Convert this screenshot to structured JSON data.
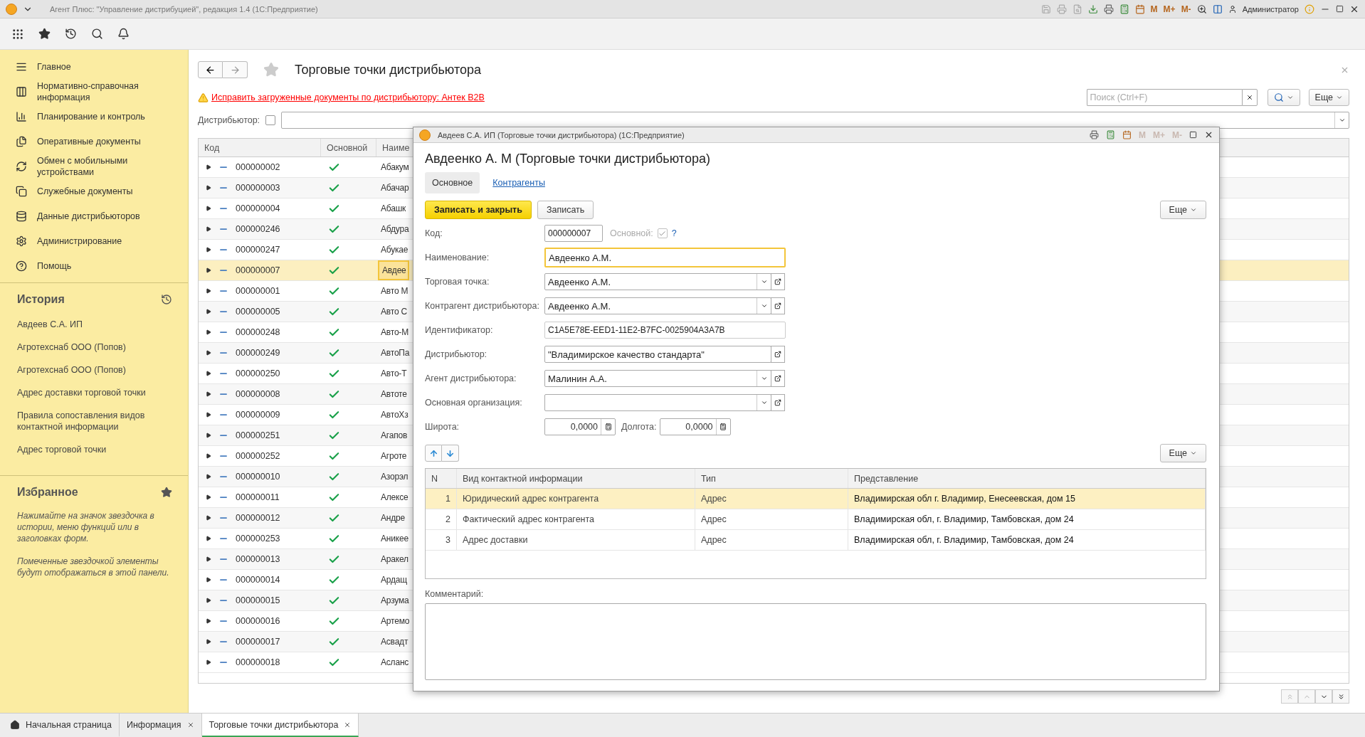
{
  "app": {
    "title": "Агент Плюс: \"Управление дистрибуцией\", редакция 1.4  (1С:Предприятие)",
    "user": "Администратор",
    "memory_buttons": [
      "M",
      "M+",
      "M-"
    ]
  },
  "sidebar": {
    "sections": [
      {
        "label": "Главное"
      },
      {
        "label": "Нормативно-справочная информация"
      },
      {
        "label": "Планирование и контроль"
      },
      {
        "label": "Оперативные документы"
      },
      {
        "label": "Обмен с мобильными устройствами"
      },
      {
        "label": "Служебные документы"
      },
      {
        "label": "Данные дистрибьюторов"
      },
      {
        "label": "Администрирование"
      },
      {
        "label": "Помощь"
      }
    ],
    "history": {
      "title": "История",
      "items": [
        "Авдеев С.А. ИП",
        "Агротехснаб ООО (Попов)",
        "Агротехснаб ООО (Попов)",
        "Адрес доставки торговой точки",
        "Правила сопоставления видов контактной информации",
        "Адрес торговой точки"
      ]
    },
    "favorites": {
      "title": "Избранное",
      "notes": [
        "Нажимайте на значок звездочка в истории, меню функций или в заголовках форм.",
        "Помеченные звездочкой элементы будут отображаться в этой панели."
      ]
    }
  },
  "page": {
    "title": "Торговые точки дистрибьютора",
    "warning": "Исправить загруженные документы по дистрибьютору: Антек B2B",
    "distributor_label": "Дистрибьютор:",
    "distributor_checked": false,
    "search_placeholder": "Поиск (Ctrl+F)",
    "more": "Еще",
    "columns": [
      "Код",
      "Основной",
      "Наиме"
    ],
    "rows": [
      {
        "code": "000000002",
        "main": true,
        "name": "Абакум",
        "selected": false
      },
      {
        "code": "000000003",
        "main": true,
        "name": "Абачар",
        "selected": false
      },
      {
        "code": "000000004",
        "main": true,
        "name": "Абашк",
        "selected": false
      },
      {
        "code": "000000246",
        "main": true,
        "name": "Абдура",
        "selected": false
      },
      {
        "code": "000000247",
        "main": true,
        "name": "Абукае",
        "selected": false
      },
      {
        "code": "000000007",
        "main": true,
        "name": "Авдее",
        "selected": true
      },
      {
        "code": "000000001",
        "main": true,
        "name": "Авто М",
        "selected": false
      },
      {
        "code": "000000005",
        "main": true,
        "name": "Авто С",
        "selected": false
      },
      {
        "code": "000000248",
        "main": true,
        "name": "Авто-М",
        "selected": false
      },
      {
        "code": "000000249",
        "main": true,
        "name": "АвтоПа",
        "selected": false
      },
      {
        "code": "000000250",
        "main": true,
        "name": "Авто-Т",
        "selected": false
      },
      {
        "code": "000000008",
        "main": true,
        "name": "Автоте",
        "selected": false
      },
      {
        "code": "000000009",
        "main": true,
        "name": "АвтоХз",
        "selected": false
      },
      {
        "code": "000000251",
        "main": true,
        "name": "Агапов",
        "selected": false
      },
      {
        "code": "000000252",
        "main": true,
        "name": "Агроте",
        "selected": false
      },
      {
        "code": "000000010",
        "main": true,
        "name": "Азорэл",
        "selected": false
      },
      {
        "code": "000000011",
        "main": true,
        "name": "Алексе",
        "selected": false
      },
      {
        "code": "000000012",
        "main": true,
        "name": "Андре",
        "selected": false
      },
      {
        "code": "000000253",
        "main": true,
        "name": "Аникее",
        "selected": false
      },
      {
        "code": "000000013",
        "main": true,
        "name": "Аракел",
        "selected": false
      },
      {
        "code": "000000014",
        "main": true,
        "name": "Ардащ",
        "selected": false
      },
      {
        "code": "000000015",
        "main": true,
        "name": "Арзума",
        "selected": false
      },
      {
        "code": "000000016",
        "main": true,
        "name": "Артемо",
        "selected": false
      },
      {
        "code": "000000017",
        "main": true,
        "name": "Асвадт",
        "selected": false
      },
      {
        "code": "000000018",
        "main": true,
        "name": "Асланс",
        "selected": false
      }
    ]
  },
  "form": {
    "window_title": "Авдеев С.А. ИП (Торговые точки дистрибьютора)  (1С:Предприятие)",
    "memory_buttons": [
      "M",
      "M+",
      "M-"
    ],
    "heading": "Авдеенко А. М  (Торговые точки дистрибьютора)",
    "tabs": [
      {
        "label": "Основное",
        "selected": true
      },
      {
        "label": "Контрагенты",
        "selected": false
      }
    ],
    "save_close": "Записать и закрыть",
    "save": "Записать",
    "more": "Еще",
    "code": {
      "label": "Код:",
      "value": "000000007",
      "main_label": "Основной:",
      "main_checked": true,
      "help": "?"
    },
    "fields": [
      {
        "kind": "input",
        "label": "Наименование:",
        "value": "Авдеенко А.М.",
        "focused": true
      },
      {
        "kind": "select",
        "label": "Торговая точка:",
        "value": "Авдеенко А.М.",
        "focused": false
      },
      {
        "kind": "select",
        "label": "Контрагент дистрибьютора:",
        "value": "Авдеенко А.М.",
        "focused": false
      },
      {
        "kind": "readonly",
        "label": "Идентификатор:",
        "value": "C1A5E78E-EED1-11E2-B7FC-0025904A3A7B",
        "focused": false
      },
      {
        "kind": "open",
        "label": "Дистрибьютор:",
        "value": "\"Владимирское качество стандарта\"",
        "focused": false
      },
      {
        "kind": "select",
        "label": "Агент дистрибьютора:",
        "value": "Малинин А.А.",
        "focused": false
      },
      {
        "kind": "select",
        "label": "Основная организация:",
        "focused": false
      }
    ],
    "latitude": {
      "label": "Широта:",
      "value": "0,0000"
    },
    "longitude": {
      "label": "Долгота:",
      "value": "0,0000"
    },
    "contacts": {
      "more": "Еще",
      "columns": [
        "N",
        "Вид контактной информации",
        "Тип",
        "Представление"
      ],
      "rows": [
        {
          "n": "1",
          "kind": "Юридический адрес контрагента",
          "type": "Адрес",
          "value": "Владимирская обл г. Владимир, Енесеевская, дом 15",
          "selected": true
        },
        {
          "n": "2",
          "kind": "Фактический адрес контрагента",
          "type": "Адрес",
          "value": "Владимирская обл, г. Владимир, Тамбовская, дом 24",
          "selected": false
        },
        {
          "n": "3",
          "kind": "Адрес доставки",
          "type": "Адрес",
          "value": "Владимирская обл, г. Владимир, Тамбовская, дом 24",
          "selected": false
        }
      ]
    },
    "comment_label": "Комментарий:"
  },
  "open_tabs": [
    {
      "label": "Начальная страница",
      "selected": false,
      "home": true,
      "closable": false
    },
    {
      "label": "Информация",
      "selected": false,
      "home": false,
      "closable": true
    },
    {
      "label": "Торговые точки дистрибьютора",
      "selected": true,
      "home": false,
      "closable": true
    }
  ]
}
